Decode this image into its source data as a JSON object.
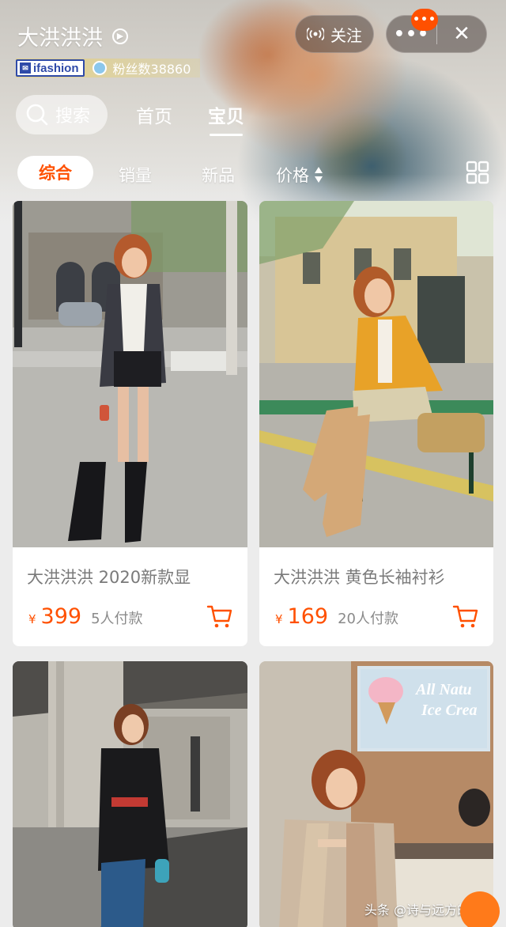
{
  "shop": {
    "name": "大洪洪洪",
    "badge": "ifashion",
    "fans": "粉丝数38860"
  },
  "follow": {
    "label": "关注"
  },
  "capsule": {
    "more": "•••",
    "message_dot": "•••"
  },
  "nav": {
    "search_label": "搜索",
    "tabs": [
      {
        "label": "首页",
        "active": false
      },
      {
        "label": "宝贝",
        "active": true
      }
    ]
  },
  "sort": {
    "items": [
      {
        "label": "综合",
        "active": true
      },
      {
        "label": "销量",
        "active": false
      },
      {
        "label": "新品",
        "active": false
      },
      {
        "label": "价格",
        "active": false
      }
    ]
  },
  "products": [
    {
      "title": "大洪洪洪 2020新款显",
      "currency": "¥",
      "price": "399",
      "buyers": "5人付款"
    },
    {
      "title": "大洪洪洪 黄色长袖衬衫",
      "currency": "¥",
      "price": "169",
      "buyers": "20人付款"
    },
    {
      "title": "",
      "currency": "",
      "price": "",
      "buyers": ""
    },
    {
      "title": "",
      "currency": "",
      "price": "",
      "buyers": ""
    }
  ],
  "sign": {
    "line1": "All Natu",
    "line2": "Ice Crea"
  },
  "watermark": "头条 @诗与远方的骗子",
  "colors": {
    "accent": "#ff5000",
    "card_bg": "#ffffff",
    "page_bg": "#ececec"
  }
}
